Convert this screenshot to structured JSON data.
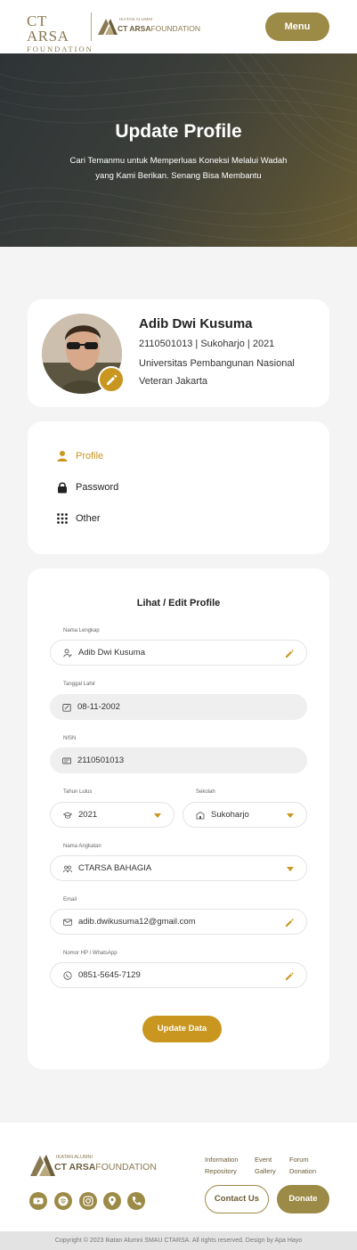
{
  "header": {
    "logo1_line1": "CT ARSA",
    "logo1_line2": "FOUNDATION",
    "logo2_small": "IKATAN ALUMNI",
    "logo2_brand": "CT ARSA",
    "logo2_rest": "FOUNDATION",
    "menu_label": "Menu"
  },
  "hero": {
    "title": "Update Profile",
    "subtitle": "Cari Temanmu untuk Memperluas Koneksi Melalui Wadah yang Kami Berikan. Senang  Bisa Membantu"
  },
  "profile": {
    "name": "Adib Dwi Kusuma",
    "meta": "2110501013 | Sukoharjo | 2021",
    "university": "Universitas Pembangunan Nasional Veteran Jakarta"
  },
  "nav": {
    "items": [
      {
        "label": "Profile",
        "icon": "user-icon",
        "active": true
      },
      {
        "label": "Password",
        "icon": "lock-icon",
        "active": false
      },
      {
        "label": "Other",
        "icon": "grid-icon",
        "active": false
      }
    ]
  },
  "form": {
    "title": "Lihat / Edit Profile",
    "nama_label": "Nama Lengkap",
    "nama_value": "Adib Dwi Kusuma",
    "tgl_label": "Tanggal Lahir",
    "tgl_value": "08-11-2002",
    "nisn_label": "NISN",
    "nisn_value": "2110501013",
    "tahun_label": "Tahun Lulus",
    "tahun_value": "2021",
    "sekolah_label": "Sekolah",
    "sekolah_value": "Sukoharjo",
    "angkatan_label": "Nama Angkatan",
    "angkatan_value": "CTARSA BAHAGIA",
    "email_label": "Email",
    "email_value": "adib.dwikusuma12@gmail.com",
    "hp_label": "Nomor HP / WhatsApp",
    "hp_value": "0851-5645-7129",
    "submit_label": "Update Data"
  },
  "footer": {
    "logo_small": "IKATAN ALUMNI",
    "logo_brand": "CT ARSA",
    "logo_rest": "FOUNDATION",
    "links": [
      "Information",
      "Event",
      "Forum",
      "Repository",
      "Gallery",
      "Donation"
    ],
    "contact_label": "Contact Us",
    "donate_label": "Donate",
    "social_icons": [
      "youtube-icon",
      "spotify-icon",
      "instagram-icon",
      "location-icon",
      "phone-icon"
    ],
    "copyright": "Copyright © 2023 Ikatan Alumni SMAU CTARSA. All rights reserved. Design by Apa Hayo"
  },
  "colors": {
    "accent": "#c9961f",
    "brand": "#9c8a47"
  }
}
